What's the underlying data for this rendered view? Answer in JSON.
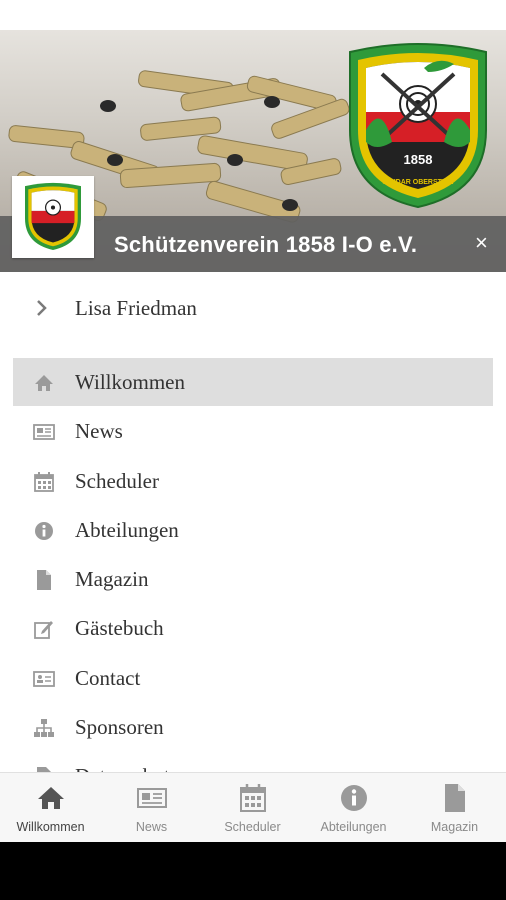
{
  "header": {
    "title": "Schützenverein 1858 I-O e.V.",
    "close_label": "×",
    "logo_year": "1858",
    "logo_ring_text": "SV IDAR OBERSTEIN"
  },
  "user": {
    "name": "Lisa Friedman"
  },
  "menu": {
    "items": [
      {
        "label": "Willkommen",
        "icon": "home-icon",
        "active": true
      },
      {
        "label": "News",
        "icon": "newspaper-icon"
      },
      {
        "label": "Scheduler",
        "icon": "calendar-icon"
      },
      {
        "label": "Abteilungen",
        "icon": "info-icon"
      },
      {
        "label": "Magazin",
        "icon": "document-icon"
      },
      {
        "label": "Gästebuch",
        "icon": "edit-icon"
      },
      {
        "label": "Contact",
        "icon": "contact-card-icon"
      },
      {
        "label": "Sponsoren",
        "icon": "sitemap-icon"
      },
      {
        "label": "Datenschutz",
        "icon": "document-icon"
      }
    ]
  },
  "bottom_nav": {
    "items": [
      {
        "label": "Willkommen",
        "icon": "home-icon",
        "active": true
      },
      {
        "label": "News",
        "icon": "newspaper-icon"
      },
      {
        "label": "Scheduler",
        "icon": "calendar-icon"
      },
      {
        "label": "Abteilungen",
        "icon": "info-icon"
      },
      {
        "label": "Magazin",
        "icon": "document-icon"
      }
    ]
  },
  "colors": {
    "header_bar": "#5f5f5f",
    "active_item_bg": "#dedede",
    "icon_gray": "#9a9a9a",
    "logo_green": "#2f9a3a",
    "logo_yellow": "#e4c400",
    "logo_red": "#d61f26"
  }
}
